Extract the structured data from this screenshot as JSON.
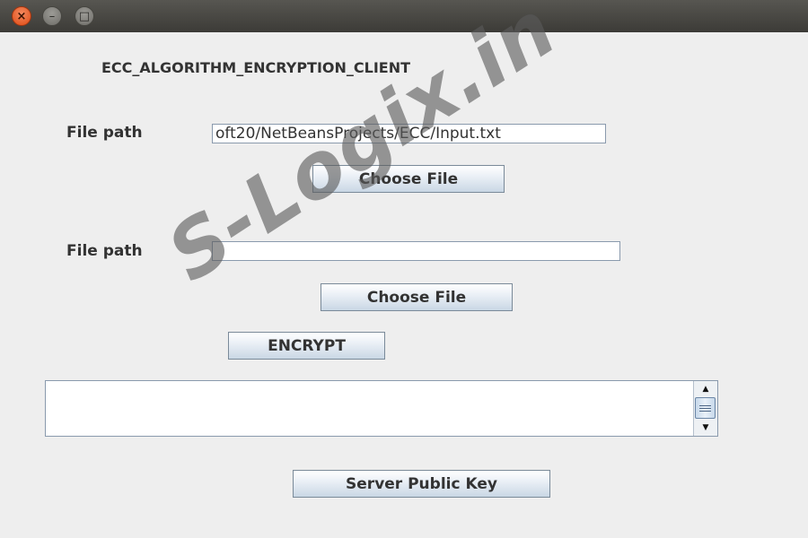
{
  "window": {
    "controls": {
      "close_glyph": "×",
      "minimize_glyph": "–",
      "maximize_glyph": "□"
    }
  },
  "form": {
    "title": "ECC_ALGORITHM_ENCRYPTION_CLIENT",
    "file1": {
      "label": "File path",
      "value": "oft20/NetBeansProjects/ECC/Input.txt",
      "button_label": "Choose File"
    },
    "file2": {
      "label": "File path",
      "value": "",
      "button_label": "Choose File"
    },
    "encrypt_label": "ENCRYPT",
    "output": {
      "value": ""
    },
    "server_key_label": "Server Public Key"
  },
  "watermark": {
    "text": "S-Logix.in"
  },
  "icons": {
    "scroll_up": "▲",
    "scroll_down": "▼"
  }
}
